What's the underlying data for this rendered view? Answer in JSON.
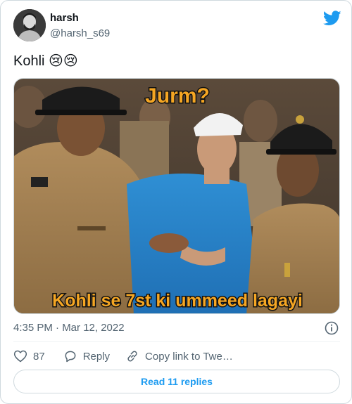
{
  "author": {
    "name": "harsh",
    "handle": "@harsh_s69"
  },
  "tweet": {
    "text": "Kohli 😢😢",
    "timestamp": "4:35 PM · Mar 12, 2022"
  },
  "media": {
    "caption_top": "Jurm?",
    "caption_bottom": "Kohli se 7st ki ummeed lagayi"
  },
  "actions": {
    "like_count": "87",
    "reply_label": "Reply",
    "copy_label": "Copy link to Twe…"
  },
  "read_replies_label": "Read 11 replies",
  "colors": {
    "brand_blue": "#1d9bf0",
    "text_primary": "#0f1419",
    "text_secondary": "#536471",
    "border": "#cfd9de"
  },
  "icons": [
    "twitter-bird-icon",
    "info-icon",
    "heart-icon",
    "reply-icon",
    "link-icon"
  ]
}
